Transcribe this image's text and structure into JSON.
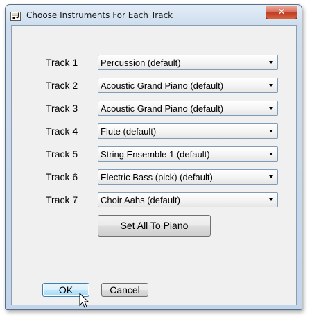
{
  "window": {
    "title": "Choose Instruments For Each Track",
    "close_label": "✕"
  },
  "tracks": [
    {
      "label": "Track 1",
      "instrument": "Percussion (default)"
    },
    {
      "label": "Track 2",
      "instrument": "Acoustic Grand Piano (default)"
    },
    {
      "label": "Track 3",
      "instrument": "Acoustic Grand Piano (default)"
    },
    {
      "label": "Track 4",
      "instrument": "Flute (default)"
    },
    {
      "label": "Track 5",
      "instrument": "String Ensemble 1 (default)"
    },
    {
      "label": "Track 6",
      "instrument": "Electric Bass (pick) (default)"
    },
    {
      "label": "Track 7",
      "instrument": "Choir Aahs (default)"
    }
  ],
  "buttons": {
    "set_all_piano": "Set All To Piano",
    "ok": "OK",
    "cancel": "Cancel"
  },
  "icons": {
    "title_icon": "music-notes-icon",
    "dropdown_arrow": "chevron-down-icon",
    "cursor": "mouse-pointer-icon"
  },
  "colors": {
    "title_gradient_top": "#e3edf7",
    "client_bg": "#f0f0f0",
    "close_button": "#c13b22",
    "default_button_border": "#3c7fb1"
  }
}
